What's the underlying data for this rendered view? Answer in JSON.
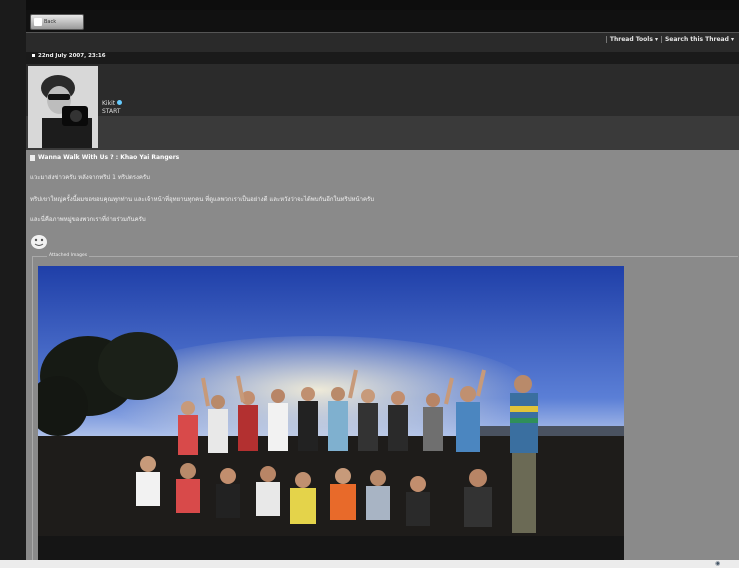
{
  "topbar": {
    "back_label": "Back"
  },
  "toolbar": {
    "thread_tools": "Thread Tools ▾",
    "search_thread": "Search this Thread ▾"
  },
  "post": {
    "date": "22nd July 2007, 23:16",
    "username": "Kikit",
    "user_subtitle": "START",
    "title": "Wanna Walk With Us ? : Khao Yai Rangers",
    "lines": [
      "แวะมาส่งข่าวครับ หลังจากทริป 1 ทริปตรงครับ",
      "ทริปเขาใหญ่ครั้งนี้ผมขอขอบคุณทุกท่าน และเจ้าหน้าที่อุทยานทุกคน ที่ดูแลพวกเราเป็นอย่างดี และหวังว่าจะได้พบกันอีกในทริปหน้าครับ",
      "และนี่คือภาพหมู่ของพวกเราที่ถ่ายร่วมกันครับ"
    ],
    "attached_label": "Attached Images"
  }
}
